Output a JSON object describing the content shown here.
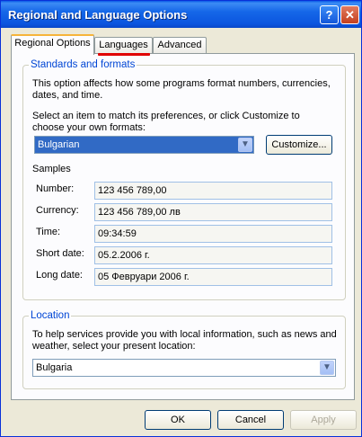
{
  "window": {
    "title": "Regional and Language Options",
    "help_glyph": "?",
    "close_glyph": "✕"
  },
  "tabs": [
    {
      "label": "Regional Options",
      "active": true
    },
    {
      "label": "Languages",
      "active": false
    },
    {
      "label": "Advanced",
      "active": false
    }
  ],
  "standards": {
    "legend": "Standards and formats",
    "description": "This option affects how some programs format numbers, currencies, dates, and time.",
    "select_prompt": "Select an item to match its preferences, or click Customize to choose your own formats:",
    "selected_format": "Bulgarian",
    "customize_label": "Customize..."
  },
  "samples": {
    "heading": "Samples",
    "rows": [
      {
        "label": "Number:",
        "value": "123 456 789,00"
      },
      {
        "label": "Currency:",
        "value": "123 456 789,00 лв"
      },
      {
        "label": "Time:",
        "value": "09:34:59"
      },
      {
        "label": "Short date:",
        "value": "05.2.2006 г."
      },
      {
        "label": "Long date:",
        "value": "05 Февруари 2006 г."
      }
    ]
  },
  "location": {
    "legend": "Location",
    "description": "To help services provide you with local information, such as news and weather, select your present location:",
    "selected_location": "Bulgaria"
  },
  "footer": {
    "ok_label": "OK",
    "cancel_label": "Cancel",
    "apply_label": "Apply"
  },
  "colors": {
    "annotation_underline": "#e00000",
    "legend_text": "#0046d5",
    "selection": "#316ac5"
  }
}
